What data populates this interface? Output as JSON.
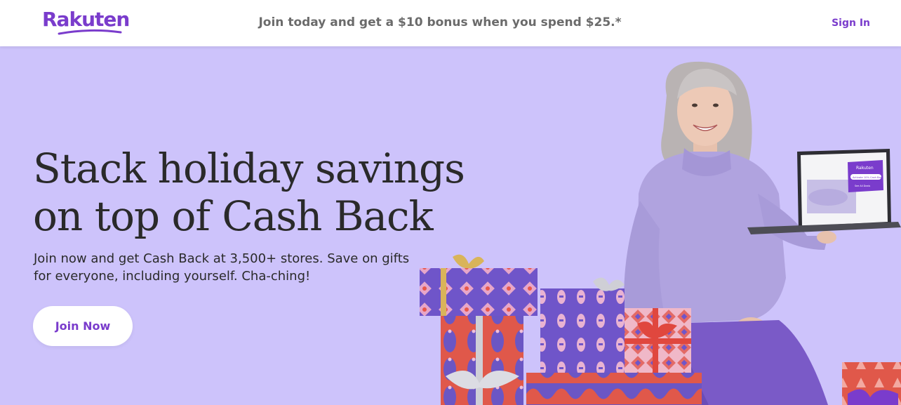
{
  "header": {
    "brand": "Rakuten",
    "promo": "Join today and get a $10 bonus when you spend $25.*",
    "signin_label": "Sign In"
  },
  "hero": {
    "headline_line1": "Stack holiday savings",
    "headline_line2": "on top of Cash Back",
    "subtext_line1": "Join now and get Cash Back at 3,500+ stores. Save on gifts",
    "subtext_line2": "for everyone, including yourself. Cha-ching!",
    "cta_label": "Join Now"
  },
  "laptop_screen": {
    "brand": "Rakuten",
    "cash_back_label": "Activate 10% Cash Back",
    "see_all_label": "See All Deals"
  },
  "colors": {
    "brand_purple": "#7a3ccc",
    "hero_background": "#cdc3fb",
    "text_dark": "#2a2a2a",
    "promo_gray": "#6b6b6b"
  }
}
